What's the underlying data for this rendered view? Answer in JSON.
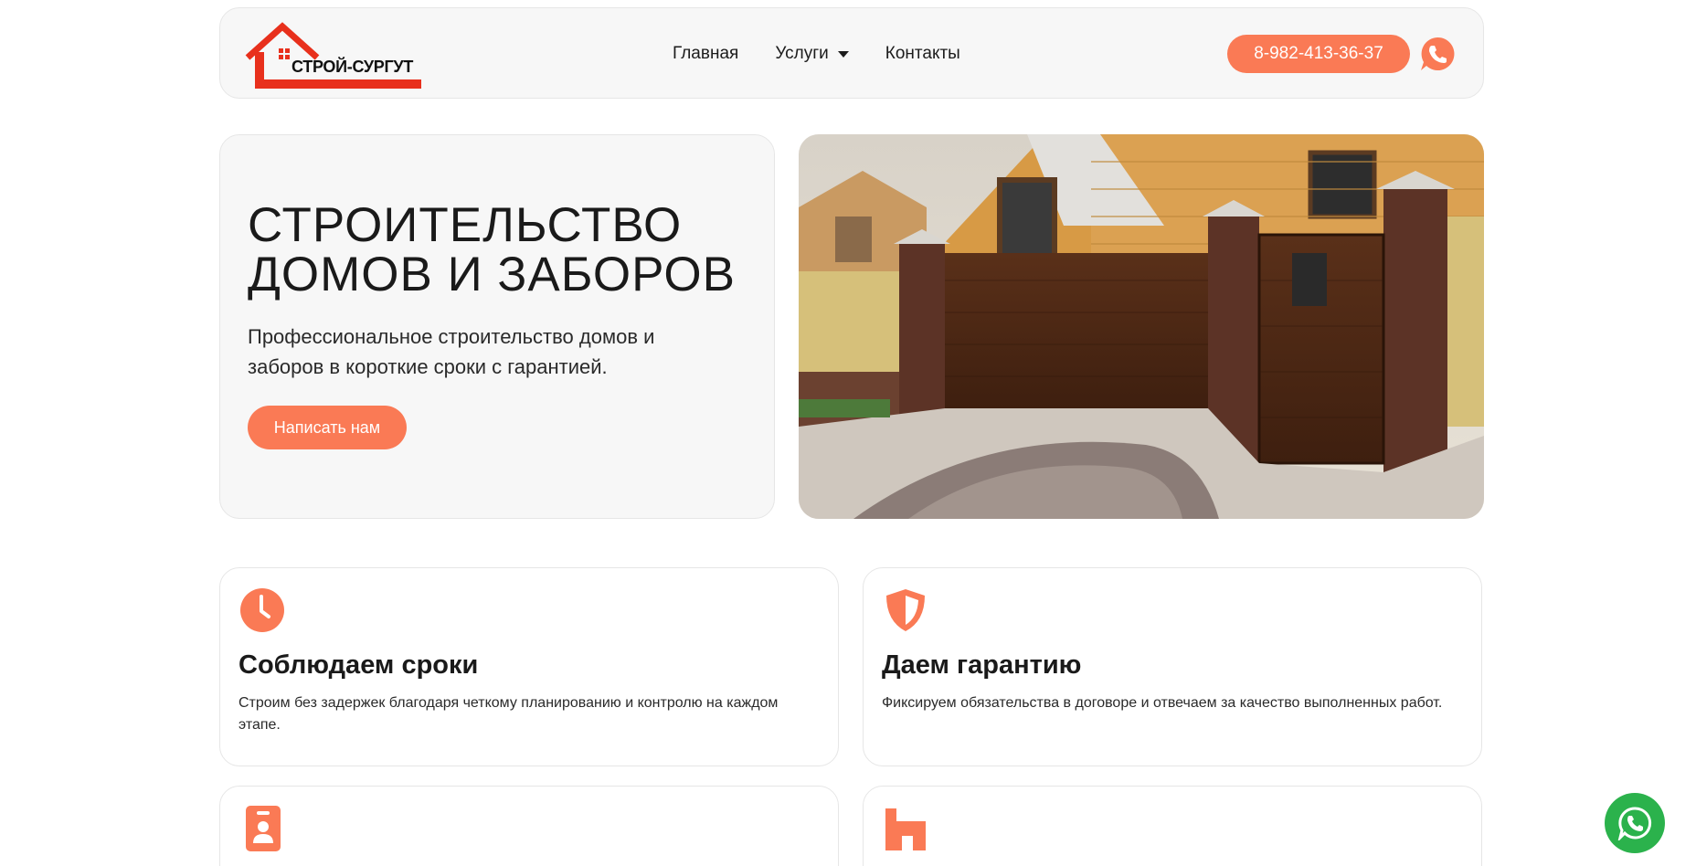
{
  "header": {
    "logo_text": "СТРОЙ-СУРГУТ",
    "nav": [
      {
        "label": "Главная"
      },
      {
        "label": "Услуги"
      },
      {
        "label": "Контакты"
      }
    ],
    "phone": "8-982-413-36-37"
  },
  "hero": {
    "title": "СТРОИТЕЛЬСТВО ДОМОВ И ЗАБОРОВ",
    "subtitle": "Профессиональное строительство домов и заборов в короткие сроки с гарантией.",
    "cta_label": "Написать нам"
  },
  "features": [
    {
      "icon": "clock-icon",
      "title": "Соблюдаем сроки",
      "text": "Строим без задержек благодаря четкому планированию и контролю на каждом этапе."
    },
    {
      "icon": "shield-icon",
      "title": "Даем гарантию",
      "text": "Фиксируем обязательства в договоре и отвечаем за качество выполненных работ."
    },
    {
      "icon": "id-badge-icon",
      "title": "",
      "text": ""
    },
    {
      "icon": "home-icon",
      "title": "",
      "text": ""
    }
  ],
  "colors": {
    "accent": "#fa7a55",
    "logo_red": "#e8301c",
    "whatsapp": "#2bb24c",
    "card_bg": "#f7f7f7"
  }
}
